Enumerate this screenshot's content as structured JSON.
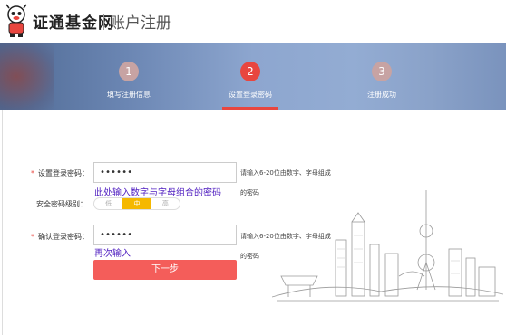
{
  "header": {
    "brand": "证通基金网",
    "title": "账户注册"
  },
  "steps": [
    {
      "num": "1",
      "label": "填写注册信息",
      "state": "done"
    },
    {
      "num": "2",
      "label": "设置登录密码",
      "state": "active"
    },
    {
      "num": "3",
      "label": "注册成功",
      "state": "pending"
    }
  ],
  "form": {
    "password": {
      "label": "设置登录密码：",
      "value": "••••••",
      "hint_line1": "请输入6-20位由数字、字母组成",
      "hint_line2": "的密码",
      "note": "此处输入数字与字母组合的密码"
    },
    "strength": {
      "label": "安全密码级别：",
      "levels": [
        "低",
        "中",
        "高"
      ],
      "selected": "中"
    },
    "confirm": {
      "label": "确认登录密码：",
      "value": "••••••",
      "hint_line1": "请输入6-20位由数字、字母组成",
      "hint_line2": "的密码",
      "note": "再次输入"
    },
    "submit_label": "下一步"
  },
  "colors": {
    "accent": "#e8463f",
    "button": "#f45d5a",
    "strength_active": "#f5b800",
    "note": "#4f1ec0"
  }
}
